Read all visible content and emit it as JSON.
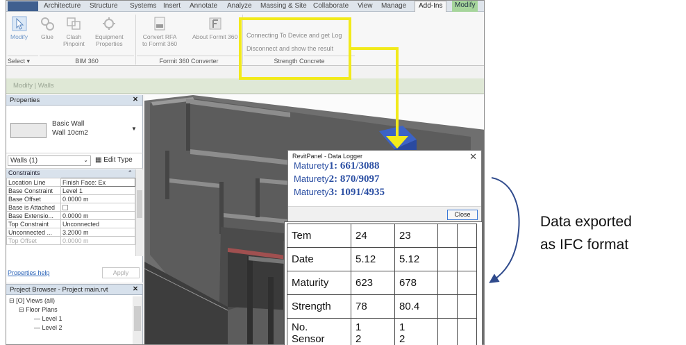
{
  "tabs": [
    "Architecture",
    "Structure",
    "Systems",
    "Insert",
    "Annotate",
    "Analyze",
    "Massing & Site",
    "Collaborate",
    "View",
    "Manage",
    "Add-Ins",
    "Modify"
  ],
  "active_tab": "Add-Ins",
  "ribbon": {
    "modify": "Modify",
    "glue": "Glue",
    "clash1": "Clash",
    "clash2": "Pinpoint",
    "equip1": "Equipment",
    "equip2": "Properties",
    "convert1": "Convert RFA",
    "convert2": "to Formit 360",
    "about": "About Formit 360",
    "link1": "Connecting To Device and get Log",
    "link2": "Disconnect and show the result",
    "panel_select": "Select ▾",
    "panel_bim": "BIM 360",
    "panel_formit": "Formit 360 Converter",
    "panel_strength": "Strength Concrete",
    "context": "Modify | Walls"
  },
  "properties": {
    "title": "Properties",
    "type_line1": "Basic Wall",
    "type_line2": "Wall 10cm2",
    "instance": "Walls (1)",
    "edit_type": "Edit Type",
    "group": "Constraints",
    "rows": [
      {
        "k": "Location Line",
        "v": "Finish Face: Ex"
      },
      {
        "k": "Base Constraint",
        "v": "Level 1"
      },
      {
        "k": "Base Offset",
        "v": "0.0000 m"
      },
      {
        "k": "Base is Attached",
        "v": ""
      },
      {
        "k": "Base Extensio...",
        "v": "0.0000 m"
      },
      {
        "k": "Top Constraint",
        "v": "Unconnected"
      },
      {
        "k": "Unconnected ...",
        "v": "3.2000 m"
      },
      {
        "k": "Top Offset",
        "v": "0.0000 m"
      }
    ],
    "help": "Properties help",
    "apply": "Apply"
  },
  "browser": {
    "title": "Project Browser - Project main.rvt",
    "views": "Views (all)",
    "floor": "Floor Plans",
    "level1": "Level 1",
    "level2": "Level 2"
  },
  "logger": {
    "title": "RevitPanel - Data Logger",
    "label": "Maturety",
    "m1_idx": "1: ",
    "m1_val": "661/3088",
    "m2_idx": "2: ",
    "m2_val": "870/9097",
    "m3_idx": "3: ",
    "m3_val": "1091/4935",
    "close": "Close"
  },
  "table": {
    "rows": [
      {
        "h": "Tem",
        "a": "24",
        "b": "23"
      },
      {
        "h": "Date",
        "a": "5.12",
        "b": "5.12"
      },
      {
        "h": "Maturity",
        "a": "623",
        "b": "678"
      },
      {
        "h": "Strength",
        "a": "78",
        "b": "80.4"
      }
    ],
    "sensor_h1": "No.",
    "sensor_h2": "Sensor",
    "sensor_a1": "1",
    "sensor_a2": "2",
    "sensor_b1": "1",
    "sensor_b2": "2"
  },
  "caption": {
    "line1": "Data exported",
    "line2": "as IFC format"
  },
  "colors": {
    "highlight": "#f2ea1b",
    "curve_arrow": "#2f4a8c",
    "logger_text": "#2b4fa3"
  }
}
